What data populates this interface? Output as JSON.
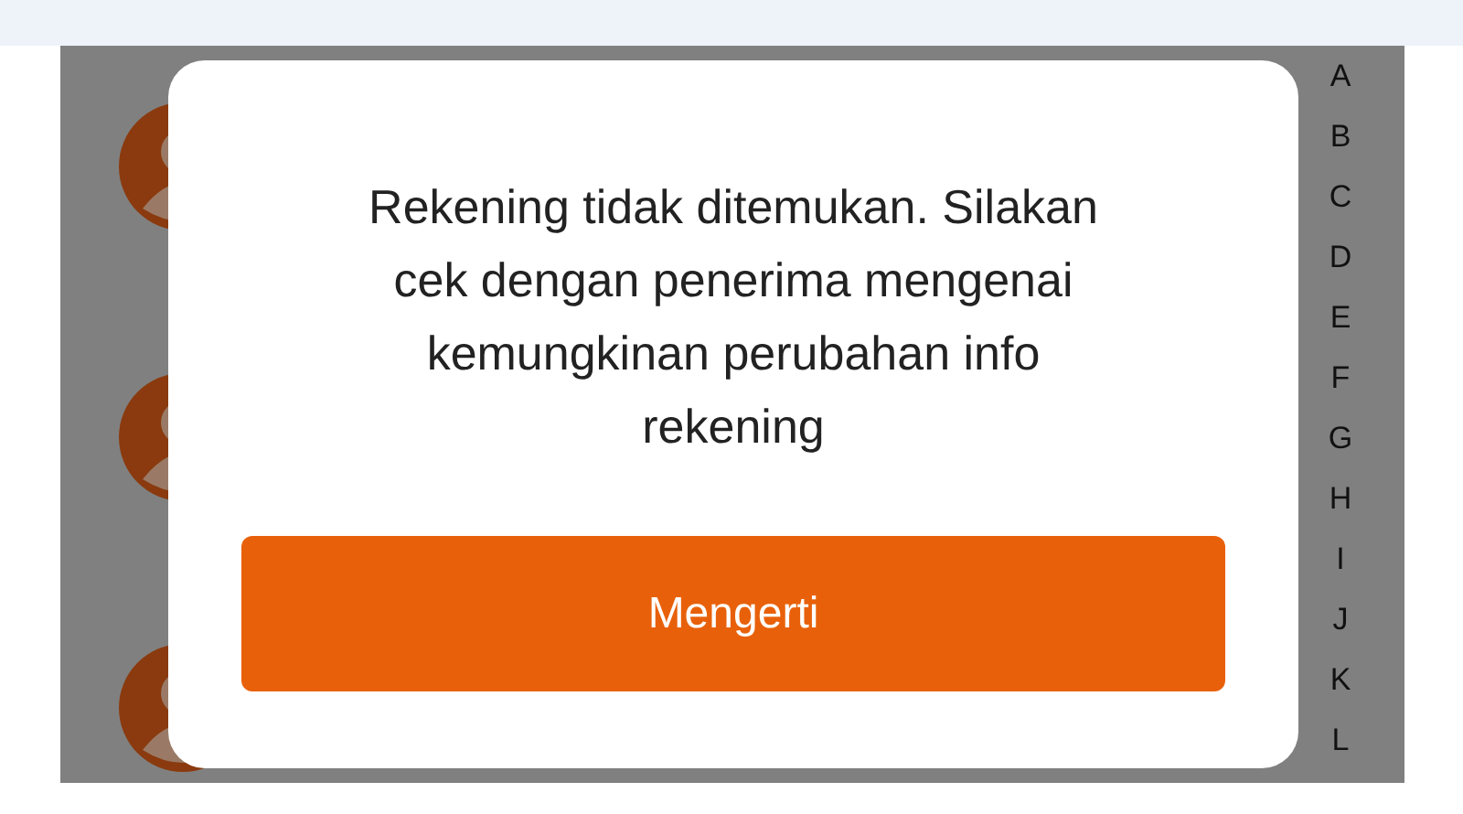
{
  "contacts": [
    {
      "kind": "avatar"
    },
    {
      "kind": "avatar"
    },
    {
      "kind": "avatar"
    }
  ],
  "index_letters": [
    "A",
    "B",
    "C",
    "D",
    "E",
    "F",
    "G",
    "H",
    "I",
    "J",
    "K",
    "L"
  ],
  "dialog": {
    "message": "Rekening tidak ditemukan. Silakan cek dengan penerima mengenai kemungkinan perubahan info rekening",
    "button": "Mengerti"
  }
}
